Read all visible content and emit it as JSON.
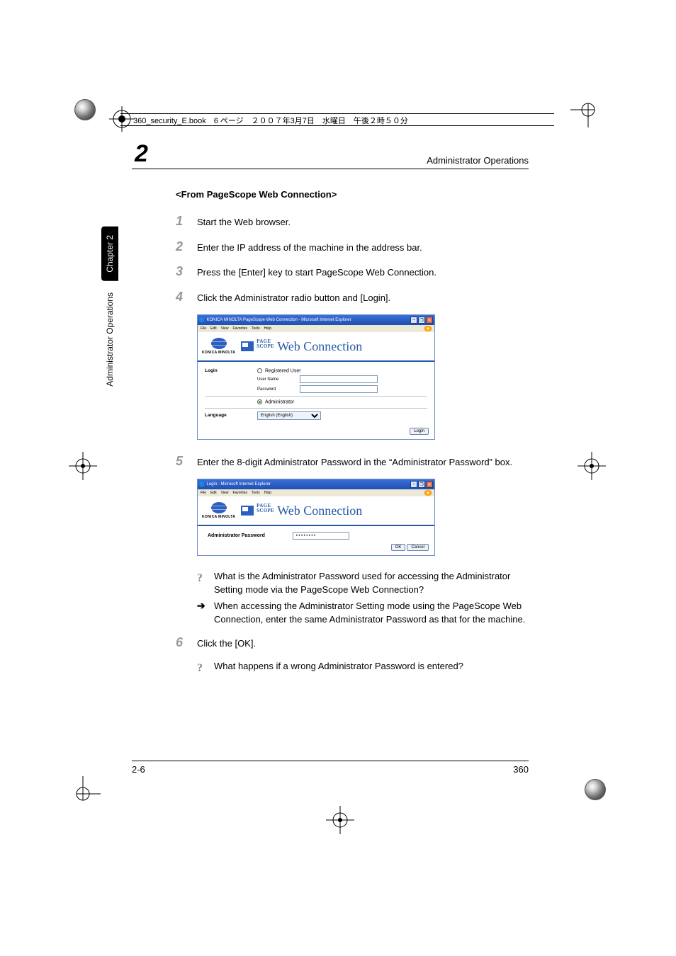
{
  "doc_header_text": "360_security_E.book　6 ページ　２００７年3月7日　水曜日　午後２時５０分",
  "running_head": {
    "chapter_number": "2",
    "title": "Administrator Operations"
  },
  "side": {
    "tab": "Chapter 2",
    "title": "Administrator Operations"
  },
  "section_heading": "<From PageScope Web Connection>",
  "steps": {
    "s1": {
      "n": "1",
      "t": "Start the Web browser."
    },
    "s2": {
      "n": "2",
      "t": "Enter the IP address of the machine in the address bar."
    },
    "s3": {
      "n": "3",
      "t": "Press the [Enter] key to start PageScope Web Connection."
    },
    "s4": {
      "n": "4",
      "t": "Click the Administrator radio button and [Login]."
    },
    "s5": {
      "n": "5",
      "t": "Enter the 8-digit Administrator Password in the “Administrator Password” box."
    },
    "s6": {
      "n": "6",
      "t": "Click the [OK]."
    }
  },
  "ie1": {
    "title": "KONICA MINOLTA PageScope Web Connection - Microsoft Internet Explorer",
    "menu": {
      "file": "File",
      "edit": "Edit",
      "view": "View",
      "fav": "Favorites",
      "tools": "Tools",
      "help": "Help"
    },
    "km_name": "KONICA MINOLTA",
    "ps_small_top": "PAGE",
    "ps_small_bot": "SCOPE",
    "ps_main": "Web Connection",
    "labels": {
      "login": "Login",
      "registered_user": "Registered User",
      "user_name": "User Name",
      "password": "Password",
      "administrator": "Administrator",
      "language": "Language"
    },
    "language_value": "English (English)",
    "login_btn": "Login"
  },
  "ie2": {
    "title": "Login - Microsoft Internet Explorer",
    "label": "Administrator Password",
    "value": "••••••••",
    "ok": "OK",
    "cancel": "Cancel"
  },
  "notes": {
    "q1": "What is the Administrator Password used for accessing the Administrator Setting mode via the PageScope Web Connection?",
    "a1": "When accessing the Administrator Setting mode using the PageScope Web Connection, enter the same Administrator Password as that for the machine.",
    "q2": "What happens if a wrong Administrator Password is entered?"
  },
  "footer": {
    "left": "2-6",
    "right": "360"
  }
}
